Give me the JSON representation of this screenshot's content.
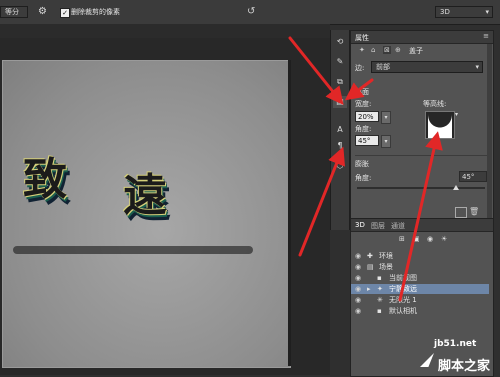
{
  "optionsbar": {
    "tool_label": "等分",
    "checkbox_label": "删除裁剪的像素",
    "workspace_value": "3D"
  },
  "properties": {
    "title": "属性",
    "sub_title": "盖子",
    "side_label": "边:",
    "side_value": "前部",
    "bevel_label": "斜面",
    "width_label": "宽度:",
    "width_value": "20%",
    "angle_label": "角度:",
    "angle_value": "45°",
    "contour_label": "等高线:",
    "inflate_label": "膨胀",
    "inflate_angle_label": "角度:",
    "inflate_angle_value": "45°"
  },
  "layers_panel": {
    "tabs": [
      "3D",
      "图层",
      "通道"
    ],
    "rows": [
      {
        "label": "环境",
        "indent": 0
      },
      {
        "label": "场景",
        "indent": 0
      },
      {
        "label": "当前视图",
        "indent": 1
      },
      {
        "label": "宁静致远",
        "indent": 1
      },
      {
        "label": "无限光 1",
        "indent": 1
      },
      {
        "label": "默认相机",
        "indent": 1
      }
    ]
  },
  "canvas": {
    "artwork_text": [
      "致",
      "遠"
    ]
  },
  "watermark": {
    "site": "jb51.net",
    "name": "脚本之家"
  },
  "colors": {
    "accent_red": "#e12727",
    "selected_row": "#6d86a8"
  }
}
